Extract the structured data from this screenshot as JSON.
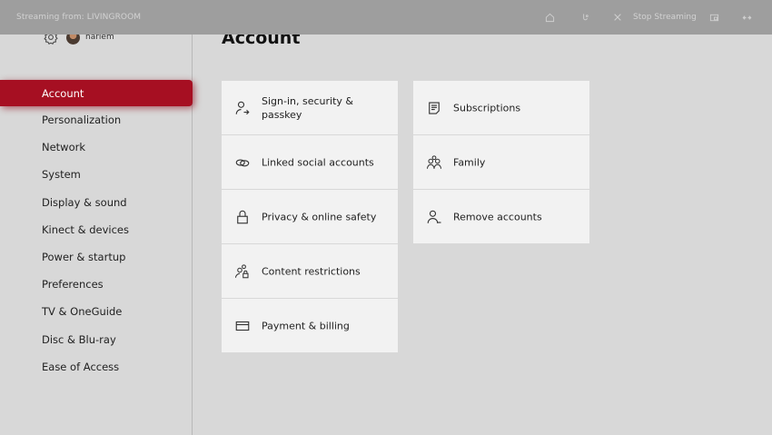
{
  "streambar": {
    "title": "Streaming from: LIVINGROOM",
    "stop_label": "Stop Streaming",
    "icons": [
      "home-icon",
      "controller-icon",
      "close-icon",
      "pip-icon",
      "fullscreen-icon"
    ]
  },
  "profile": {
    "username": "harlem"
  },
  "sidebar": {
    "items": [
      {
        "label": "Account"
      },
      {
        "label": "Personalization"
      },
      {
        "label": "Network"
      },
      {
        "label": "System"
      },
      {
        "label": "Display & sound"
      },
      {
        "label": "Kinect & devices"
      },
      {
        "label": "Power & startup"
      },
      {
        "label": "Preferences"
      },
      {
        "label": "TV & OneGuide"
      },
      {
        "label": "Disc & Blu-ray"
      },
      {
        "label": "Ease of Access"
      }
    ],
    "active_index": 0
  },
  "main": {
    "title": "Account",
    "tiles": [
      {
        "label": "Sign-in, security & passkey",
        "icon": "person-arrow-icon"
      },
      {
        "label": "Linked social accounts",
        "icon": "link-icon"
      },
      {
        "label": "Privacy & online safety",
        "icon": "lock-icon"
      },
      {
        "label": "Content restrictions",
        "icon": "people-lock-icon"
      },
      {
        "label": "Payment & billing",
        "icon": "credit-card-icon"
      },
      {
        "label": "Subscriptions",
        "icon": "document-icon"
      },
      {
        "label": "Family",
        "icon": "family-icon"
      },
      {
        "label": "Remove accounts",
        "icon": "person-minus-icon"
      }
    ]
  },
  "colors": {
    "accent": "#a60f22",
    "background": "#d8d8d8",
    "tile": "#f2f2f2",
    "streambar": "#9e9e9e"
  }
}
